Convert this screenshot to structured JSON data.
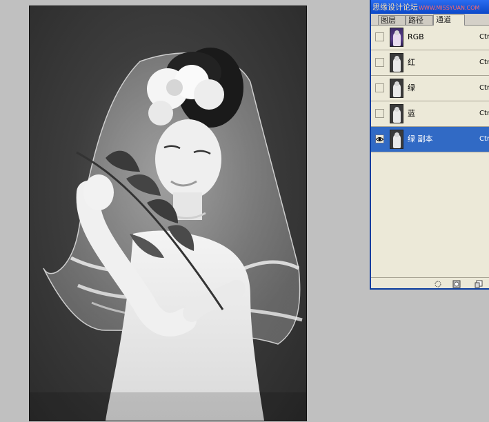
{
  "panel": {
    "watermark_text": "思缘设计论坛",
    "watermark_url": "WWW.MISSYUAN.COM",
    "tabs": [
      {
        "label": "图层",
        "active": false
      },
      {
        "label": "路径",
        "active": false
      },
      {
        "label": "通道",
        "active": true
      }
    ],
    "channels": [
      {
        "name": "RGB",
        "shortcut": "Ctrl",
        "visible": false,
        "selected": false,
        "thumb": "color"
      },
      {
        "name": "红",
        "shortcut": "Ctrl",
        "visible": false,
        "selected": false,
        "thumb": "gray"
      },
      {
        "name": "绿",
        "shortcut": "Ctrl",
        "visible": false,
        "selected": false,
        "thumb": "gray"
      },
      {
        "name": "蓝",
        "shortcut": "Ctrl",
        "visible": false,
        "selected": false,
        "thumb": "gray"
      },
      {
        "name": "绿 副本",
        "shortcut": "Ctrl",
        "visible": true,
        "selected": true,
        "thumb": "gray"
      }
    ],
    "bottom_icons": [
      "load-selection-icon",
      "save-selection-icon",
      "new-channel-icon"
    ]
  },
  "colors": {
    "panel_bg": "#ece9d8",
    "selected_row": "#316ac5",
    "titlebar": "#0b48c8",
    "app_bg": "#c0c0c0"
  }
}
